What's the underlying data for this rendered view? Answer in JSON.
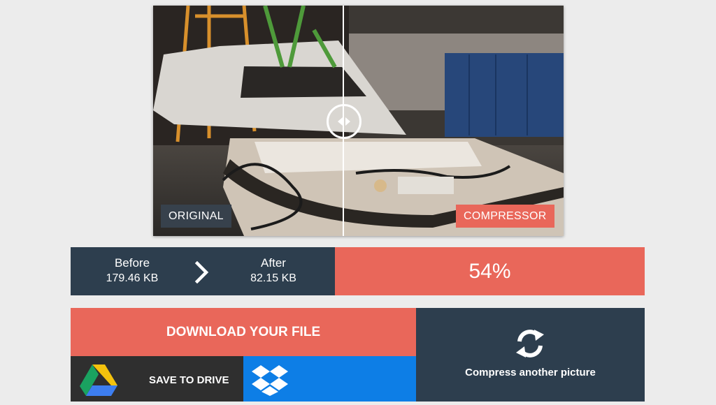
{
  "compare": {
    "original_label": "ORIGINAL",
    "compressed_label": "COMPRESSOR"
  },
  "stats": {
    "before_label": "Before",
    "before_value": "179.46 KB",
    "after_label": "After",
    "after_value": "82.15 KB",
    "reduction": "54%"
  },
  "actions": {
    "download_label": "DOWNLOAD YOUR FILE",
    "drive_label": "SAVE TO DRIVE",
    "compress_another_label": "Compress another picture"
  },
  "icons": {
    "chevron": "chevron-right-icon",
    "drive": "google-drive-icon",
    "dropbox": "dropbox-icon",
    "refresh": "refresh-icon",
    "handle": "compare-handle-icon"
  },
  "colors": {
    "accent": "#e9675a",
    "dark": "#2d3e4e",
    "drive_bg": "#2f2f2f",
    "dropbox_bg": "#0d7ee6"
  }
}
